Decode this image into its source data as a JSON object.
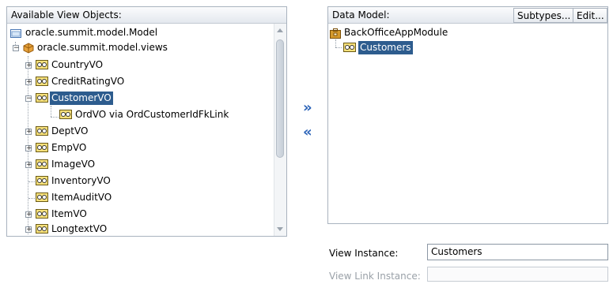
{
  "left_panel": {
    "title": "Available View Objects:",
    "tree": [
      {
        "label": "oracle.summit.model.Model",
        "icon": "folder-icon"
      },
      {
        "label": "oracle.summit.model.views",
        "icon": "package-icon"
      },
      {
        "label": "CountryVO",
        "icon": "view-object-icon"
      },
      {
        "label": "CreditRatingVO",
        "icon": "view-object-icon"
      },
      {
        "label": "CustomerVO",
        "icon": "view-object-icon"
      },
      {
        "label": "OrdVO via OrdCustomerIdFkLink",
        "icon": "view-object-icon"
      },
      {
        "label": "DeptVO",
        "icon": "view-object-icon"
      },
      {
        "label": "EmpVO",
        "icon": "view-object-icon"
      },
      {
        "label": "ImageVO",
        "icon": "view-object-icon"
      },
      {
        "label": "InventoryVO",
        "icon": "view-object-icon"
      },
      {
        "label": "ItemAuditVO",
        "icon": "view-object-icon"
      },
      {
        "label": "ItemVO",
        "icon": "view-object-icon"
      },
      {
        "label": "LongtextVO",
        "icon": "view-object-icon"
      }
    ]
  },
  "shuttle": {
    "add_symbol": "»",
    "remove_symbol": "«"
  },
  "right_panel": {
    "title": "Data Model:",
    "subtypes_button": "Subtypes...",
    "edit_button": "Edit...",
    "tree": [
      {
        "label": "BackOfficeAppModule",
        "icon": "app-module-icon"
      },
      {
        "label": "Customers",
        "icon": "view-instance-icon"
      }
    ]
  },
  "form": {
    "view_instance_label": "View Instance:",
    "view_instance_value": "Customers",
    "view_link_instance_label": "View Link Instance:",
    "view_link_instance_value": ""
  },
  "colors": {
    "selection": "#2d5c8e",
    "shuttle_arrow": "#2b63b8"
  }
}
